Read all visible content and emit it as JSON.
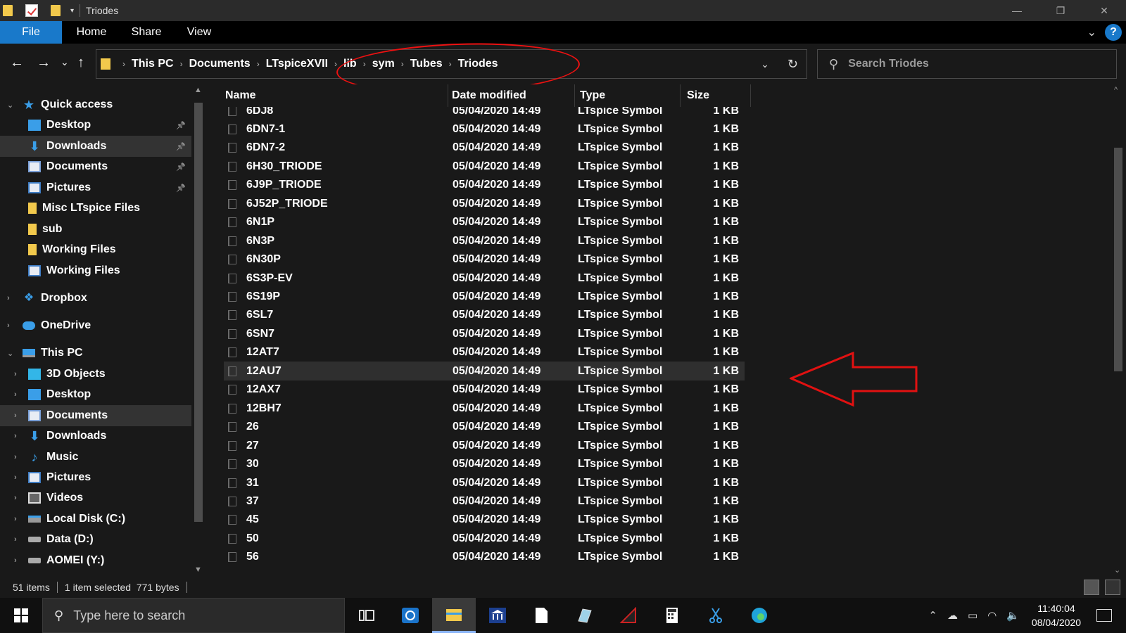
{
  "window": {
    "title": "Triodes",
    "controls": {
      "minimize": "—",
      "maximize": "❐",
      "close": "✕"
    }
  },
  "ribbon": {
    "tabs": [
      "File",
      "Home",
      "Share",
      "View"
    ],
    "help": "?"
  },
  "nav": {
    "back": "←",
    "forward": "→",
    "recent": "⌄",
    "up": "↑",
    "breadcrumbs": [
      "This PC",
      "Documents",
      "LTspiceXVII",
      "lib",
      "sym",
      "Tubes",
      "Triodes"
    ],
    "search_placeholder": "Search Triodes"
  },
  "sidebar": {
    "items": [
      {
        "label": "Quick access",
        "icon": "star-icon",
        "level": 0,
        "expanded": true
      },
      {
        "label": "Desktop",
        "icon": "desktop-icon",
        "level": 1,
        "pinned": true
      },
      {
        "label": "Downloads",
        "icon": "download-icon",
        "level": 1,
        "pinned": true,
        "selected": true
      },
      {
        "label": "Documents",
        "icon": "documents-icon",
        "level": 1,
        "pinned": true
      },
      {
        "label": "Pictures",
        "icon": "pictures-icon",
        "level": 1,
        "pinned": true
      },
      {
        "label": "Misc LTspice Files",
        "icon": "folder-icon",
        "level": 1
      },
      {
        "label": "sub",
        "icon": "folder-icon",
        "level": 1
      },
      {
        "label": "Working Files",
        "icon": "folder-icon",
        "level": 1
      },
      {
        "label": "Working Files",
        "icon": "network-folder-icon",
        "level": 1
      },
      {
        "label": "Dropbox",
        "icon": "dropbox-icon",
        "level": 0
      },
      {
        "label": "OneDrive",
        "icon": "cloud-icon",
        "level": 0
      },
      {
        "label": "This PC",
        "icon": "computer-icon",
        "level": 0,
        "expanded": true
      },
      {
        "label": "3D Objects",
        "icon": "3d-objects-icon",
        "level": 1
      },
      {
        "label": "Desktop",
        "icon": "desktop-icon",
        "level": 1
      },
      {
        "label": "Documents",
        "icon": "documents-icon",
        "level": 1,
        "selected": true
      },
      {
        "label": "Downloads",
        "icon": "download-icon",
        "level": 1
      },
      {
        "label": "Music",
        "icon": "music-icon",
        "level": 1
      },
      {
        "label": "Pictures",
        "icon": "pictures-icon",
        "level": 1
      },
      {
        "label": "Videos",
        "icon": "videos-icon",
        "level": 1
      },
      {
        "label": "Local Disk (C:)",
        "icon": "local-disk-icon",
        "level": 1
      },
      {
        "label": "Data (D:)",
        "icon": "drive-icon",
        "level": 1
      },
      {
        "label": "AOMEI (Y:)",
        "icon": "drive-icon",
        "level": 1
      }
    ]
  },
  "files": {
    "columns": [
      "Name",
      "Date modified",
      "Type",
      "Size"
    ],
    "rows": [
      {
        "name": "6DJ8",
        "date": "05/04/2020 14:49",
        "type": "LTspice Symbol",
        "size": "1 KB"
      },
      {
        "name": "6DN7-1",
        "date": "05/04/2020 14:49",
        "type": "LTspice Symbol",
        "size": "1 KB"
      },
      {
        "name": "6DN7-2",
        "date": "05/04/2020 14:49",
        "type": "LTspice Symbol",
        "size": "1 KB"
      },
      {
        "name": "6H30_TRIODE",
        "date": "05/04/2020 14:49",
        "type": "LTspice Symbol",
        "size": "1 KB"
      },
      {
        "name": "6J9P_TRIODE",
        "date": "05/04/2020 14:49",
        "type": "LTspice Symbol",
        "size": "1 KB"
      },
      {
        "name": "6J52P_TRIODE",
        "date": "05/04/2020 14:49",
        "type": "LTspice Symbol",
        "size": "1 KB"
      },
      {
        "name": "6N1P",
        "date": "05/04/2020 14:49",
        "type": "LTspice Symbol",
        "size": "1 KB"
      },
      {
        "name": "6N3P",
        "date": "05/04/2020 14:49",
        "type": "LTspice Symbol",
        "size": "1 KB"
      },
      {
        "name": "6N30P",
        "date": "05/04/2020 14:49",
        "type": "LTspice Symbol",
        "size": "1 KB"
      },
      {
        "name": "6S3P-EV",
        "date": "05/04/2020 14:49",
        "type": "LTspice Symbol",
        "size": "1 KB"
      },
      {
        "name": "6S19P",
        "date": "05/04/2020 14:49",
        "type": "LTspice Symbol",
        "size": "1 KB"
      },
      {
        "name": "6SL7",
        "date": "05/04/2020 14:49",
        "type": "LTspice Symbol",
        "size": "1 KB"
      },
      {
        "name": "6SN7",
        "date": "05/04/2020 14:49",
        "type": "LTspice Symbol",
        "size": "1 KB"
      },
      {
        "name": "12AT7",
        "date": "05/04/2020 14:49",
        "type": "LTspice Symbol",
        "size": "1 KB"
      },
      {
        "name": "12AU7",
        "date": "05/04/2020 14:49",
        "type": "LTspice Symbol",
        "size": "1 KB",
        "highlighted": true
      },
      {
        "name": "12AX7",
        "date": "05/04/2020 14:49",
        "type": "LTspice Symbol",
        "size": "1 KB"
      },
      {
        "name": "12BH7",
        "date": "05/04/2020 14:49",
        "type": "LTspice Symbol",
        "size": "1 KB"
      },
      {
        "name": "26",
        "date": "05/04/2020 14:49",
        "type": "LTspice Symbol",
        "size": "1 KB"
      },
      {
        "name": "27",
        "date": "05/04/2020 14:49",
        "type": "LTspice Symbol",
        "size": "1 KB"
      },
      {
        "name": "30",
        "date": "05/04/2020 14:49",
        "type": "LTspice Symbol",
        "size": "1 KB"
      },
      {
        "name": "31",
        "date": "05/04/2020 14:49",
        "type": "LTspice Symbol",
        "size": "1 KB"
      },
      {
        "name": "37",
        "date": "05/04/2020 14:49",
        "type": "LTspice Symbol",
        "size": "1 KB"
      },
      {
        "name": "45",
        "date": "05/04/2020 14:49",
        "type": "LTspice Symbol",
        "size": "1 KB"
      },
      {
        "name": "50",
        "date": "05/04/2020 14:49",
        "type": "LTspice Symbol",
        "size": "1 KB"
      },
      {
        "name": "56",
        "date": "05/04/2020 14:49",
        "type": "LTspice Symbol",
        "size": "1 KB"
      }
    ]
  },
  "status": {
    "item_count": "51 items",
    "selection": "1 item selected  771 bytes"
  },
  "taskbar": {
    "search_placeholder": "Type here to search",
    "time": "11:40:04",
    "date": "08/04/2020"
  },
  "colors": {
    "accent": "#1979ca",
    "background": "#191919",
    "annotation": "#e11111"
  }
}
